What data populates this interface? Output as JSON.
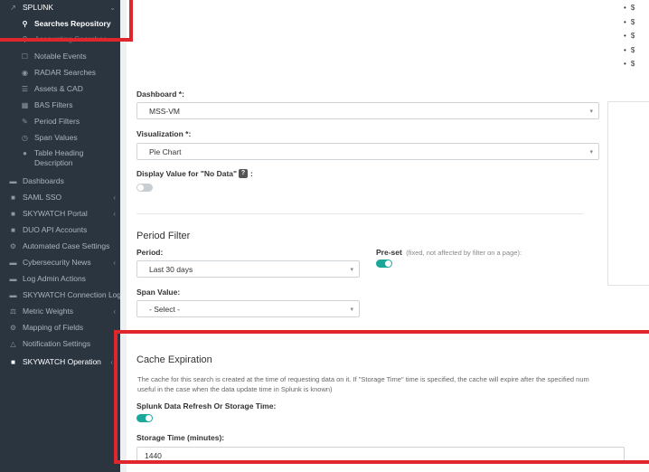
{
  "sidebar": {
    "splunk": {
      "label": "SPLUNK",
      "icon": "chart-line-icon"
    },
    "items": [
      {
        "label": "Searches Repository",
        "icon": "search-icon",
        "active": true
      },
      {
        "label": "Accounting Searches",
        "icon": "search-icon"
      },
      {
        "label": "Notable Events",
        "icon": "square-icon"
      },
      {
        "label": "RADAR Searches",
        "icon": "radar-icon"
      },
      {
        "label": "Assets & CAD",
        "icon": "sliders-icon"
      },
      {
        "label": "BAS Filters",
        "icon": "calendar-icon"
      },
      {
        "label": "Period Filters",
        "icon": "edit-icon"
      },
      {
        "label": "Span Values",
        "icon": "clock-icon"
      },
      {
        "label": "Table Heading Description",
        "icon": "info-icon"
      }
    ],
    "top_items": [
      {
        "label": "Dashboards",
        "icon": "dashboard-icon",
        "chevron": false
      },
      {
        "label": "SAML SSO",
        "icon": "lock-icon",
        "chevron": true
      },
      {
        "label": "SKYWATCH Portal",
        "icon": "lock-icon",
        "chevron": true
      },
      {
        "label": "DUO API Accounts",
        "icon": "lock-icon",
        "chevron": false
      },
      {
        "label": "Automated Case Settings",
        "icon": "cogs-icon",
        "chevron": false
      },
      {
        "label": "Cybersecurity News",
        "icon": "newspaper-icon",
        "chevron": true
      },
      {
        "label": "Log Admin Actions",
        "icon": "list-icon",
        "chevron": false
      },
      {
        "label": "SKYWATCH Connection Log",
        "icon": "list-icon",
        "chevron": false
      },
      {
        "label": "Metric Weights",
        "icon": "balance-icon",
        "chevron": true
      },
      {
        "label": "Mapping of Fields",
        "icon": "cogs-icon",
        "chevron": false
      },
      {
        "label": "Notification Settings",
        "icon": "bell-icon",
        "chevron": false
      }
    ],
    "operation": {
      "label": "SKYWATCH Operation",
      "icon": "lock-icon"
    }
  },
  "main": {
    "bullets": [
      "$",
      "$",
      "$",
      "$",
      "$"
    ],
    "dashboard": {
      "label": "Dashboard *:",
      "value": "MSS-VM"
    },
    "visualization": {
      "label": "Visualization *:",
      "value": "Pie Chart"
    },
    "no_data": {
      "label": "Display Value for \"No Data\"",
      "suffix": ":",
      "on": false
    },
    "period_filter": {
      "title": "Period Filter",
      "period_label": "Period:",
      "period_value": "Last 30 days",
      "preset_label": "Pre-set",
      "preset_note": "(fixed, not affected by filter on a page):",
      "preset_on": true,
      "span_label": "Span Value:",
      "span_value": "- Select -"
    },
    "cache": {
      "title": "Cache Expiration",
      "desc_line1": "The cache for this search is created at the time of requesting data on it. If \"Storage Time\" time is specified, the cache will expire after the specified num",
      "desc_line2": "useful in the case when the data update time in Splunk is known)",
      "refresh_label": "Splunk Data Refresh Or Storage Time:",
      "refresh_on": true,
      "storage_label": "Storage Time (minutes):",
      "storage_value": "1440"
    }
  },
  "colors": {
    "highlight": "#e0262d",
    "toggle_on": "#1aa89b",
    "sidebar_bg": "#2b3540"
  }
}
